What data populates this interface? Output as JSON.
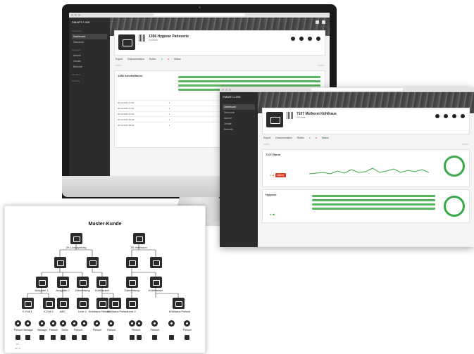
{
  "imac_screen": {
    "brand": "SMART-LINK",
    "nav_sections": [
      "Steuerung",
      "Übersicht",
      "Mandant",
      "Wartung"
    ],
    "nav_items": [
      {
        "label": "Dashboard",
        "active": true
      },
      {
        "label": "Standorte",
        "active": false
      },
      {
        "label": "Alarme",
        "active": false
      },
      {
        "label": "Geräte",
        "active": false
      },
      {
        "label": "Berichte",
        "active": false
      }
    ],
    "page_title": "1356 Hygiene Patisserie",
    "page_sub": "Zentrale",
    "toolbar": [
      "Export",
      "Dokumentation",
      "Rollen",
      "Status"
    ],
    "panel_title": "1356 Arbeitsfläche",
    "table_rows": [
      "20.12.2022 12:00",
      "20.12.2022 11:00",
      "20.12.2022 10:00",
      "20.12.2022 09:00",
      "20.12.2022 08:00"
    ]
  },
  "laptop_window": {
    "brand": "SMART-LINK",
    "nav_items": [
      {
        "label": "Dashboard",
        "active": true
      },
      {
        "label": "Standorte",
        "active": false
      },
      {
        "label": "Alarme",
        "active": false
      },
      {
        "label": "Geräte",
        "active": false
      },
      {
        "label": "Berichte",
        "active": false
      }
    ],
    "page_title": "7107 Molkerei Kühlhaus",
    "page_sub": "Zentrale",
    "toolbar": [
      "Export",
      "Dokumentation",
      "Rollen",
      "Status"
    ],
    "panels": [
      {
        "title": "7107 Raum",
        "alarm_label": "Alarm"
      },
      {
        "title": "Hygiene"
      }
    ]
  },
  "document": {
    "title": "Muster-Kunde",
    "level1": [
      "ZK Ludwigsburg",
      "ZK Heilbronn"
    ],
    "level3": [
      "Ausgabe 1",
      "Ausgabe 2",
      "Zubereitung",
      "Kühlhauser",
      "Zubereitung",
      "Kühlhauser"
    ],
    "level4": [
      "K-Fall 1",
      "K-Fall 2",
      "ABC",
      "Linie 2",
      "Kühlhaus Fleisch",
      "Kühlhaus Fleisch",
      "Linie 2",
      "Kühlhaus Fleisch"
    ],
    "sensor_labels": [
      "Fleisch",
      "Beilage",
      "Beilage",
      "Fleisch",
      "Soße",
      "Fleisch",
      "Fleisch",
      "Fleisch",
      "Fleisch",
      "Fleisch",
      "Fleisch"
    ],
    "footer_labels": [
      "2C",
      "4C °C"
    ]
  },
  "colors": {
    "ok": "#3aa846",
    "alarm": "#d9412c",
    "sidebar": "#2c2c2c"
  }
}
